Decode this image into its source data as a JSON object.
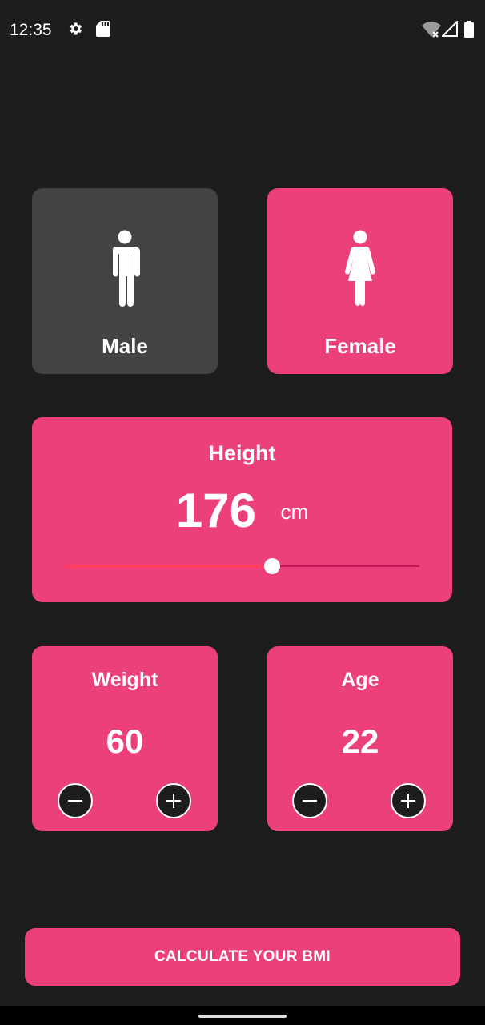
{
  "status_bar": {
    "time": "12:35",
    "icons": [
      "settings-gear-icon",
      "sd-card-icon",
      "wifi-off-icon",
      "cell-signal-icon",
      "battery-icon"
    ]
  },
  "gender": {
    "male_label": "Male",
    "female_label": "Female",
    "selected": "Female"
  },
  "height": {
    "title": "Height",
    "value": "176",
    "unit": "cm",
    "slider_fraction": 0.585
  },
  "weight": {
    "title": "Weight",
    "value": "60"
  },
  "age": {
    "title": "Age",
    "value": "22"
  },
  "calculate_label": "CALCULATE YOUR BMI",
  "colors": {
    "background": "#1d1d1d",
    "accent": "#ec407a",
    "inactive_card": "#434343",
    "slider_active": "#ff3d5e",
    "slider_inactive": "#c2185b"
  }
}
